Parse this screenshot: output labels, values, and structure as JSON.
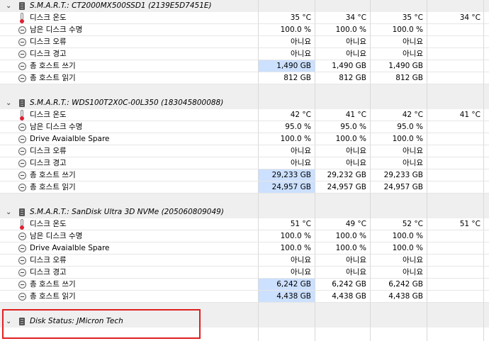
{
  "sections": [
    {
      "title": "S.M.A.R.T.: CT2000MX500SSD1 (2139E5D7451E)",
      "rows": [
        {
          "icon": "thermometer-icon",
          "label": "디스크 온도",
          "values": [
            "35 °C",
            "34 °C",
            "35 °C",
            "34 °C"
          ],
          "highlight": false
        },
        {
          "icon": "gauge-icon",
          "label": "남은 디스크 수명",
          "values": [
            "100.0 %",
            "100.0 %",
            "100.0 %",
            ""
          ],
          "highlight": false
        },
        {
          "icon": "gauge-icon",
          "label": "디스크 오류",
          "values": [
            "아니요",
            "아니요",
            "아니요",
            ""
          ],
          "highlight": false
        },
        {
          "icon": "gauge-icon",
          "label": "디스크 경고",
          "values": [
            "아니요",
            "아니요",
            "아니요",
            ""
          ],
          "highlight": false
        },
        {
          "icon": "gauge-icon",
          "label": "총 호스트 쓰기",
          "values": [
            "1,490 GB",
            "1,490 GB",
            "1,490 GB",
            ""
          ],
          "highlight": true
        },
        {
          "icon": "gauge-icon",
          "label": "총 호스트 읽기",
          "values": [
            "812 GB",
            "812 GB",
            "812 GB",
            ""
          ],
          "highlight": false
        }
      ]
    },
    {
      "title": "S.M.A.R.T.: WDS100T2X0C-00L350 (183045800088)",
      "rows": [
        {
          "icon": "thermometer-icon",
          "label": "디스크 온도",
          "values": [
            "42 °C",
            "41 °C",
            "42 °C",
            "41 °C"
          ],
          "highlight": false
        },
        {
          "icon": "gauge-icon",
          "label": "남은 디스크 수명",
          "values": [
            "95.0 %",
            "95.0 %",
            "95.0 %",
            ""
          ],
          "highlight": false
        },
        {
          "icon": "gauge-icon",
          "label": "Drive Avaialble Spare",
          "values": [
            "100.0 %",
            "100.0 %",
            "100.0 %",
            ""
          ],
          "highlight": false
        },
        {
          "icon": "gauge-icon",
          "label": "디스크 오류",
          "values": [
            "아니요",
            "아니요",
            "아니요",
            ""
          ],
          "highlight": false
        },
        {
          "icon": "gauge-icon",
          "label": "디스크 경고",
          "values": [
            "아니요",
            "아니요",
            "아니요",
            ""
          ],
          "highlight": false
        },
        {
          "icon": "gauge-icon",
          "label": "총 호스트 쓰기",
          "values": [
            "29,233 GB",
            "29,232 GB",
            "29,233 GB",
            ""
          ],
          "highlight": true
        },
        {
          "icon": "gauge-icon",
          "label": "총 호스트 읽기",
          "values": [
            "24,957 GB",
            "24,957 GB",
            "24,957 GB",
            ""
          ],
          "highlight": true
        }
      ]
    },
    {
      "title": "S.M.A.R.T.: SanDisk Ultra 3D NVMe (205060809049)",
      "rows": [
        {
          "icon": "thermometer-icon",
          "label": "디스크 온도",
          "values": [
            "51 °C",
            "49 °C",
            "52 °C",
            "51 °C"
          ],
          "highlight": false
        },
        {
          "icon": "gauge-icon",
          "label": "남은 디스크 수명",
          "values": [
            "100.0 %",
            "100.0 %",
            "100.0 %",
            ""
          ],
          "highlight": false
        },
        {
          "icon": "gauge-icon",
          "label": "Drive Avaialble Spare",
          "values": [
            "100.0 %",
            "100.0 %",
            "100.0 %",
            ""
          ],
          "highlight": false
        },
        {
          "icon": "gauge-icon",
          "label": "디스크 오류",
          "values": [
            "아니요",
            "아니요",
            "아니요",
            ""
          ],
          "highlight": false
        },
        {
          "icon": "gauge-icon",
          "label": "디스크 경고",
          "values": [
            "아니요",
            "아니요",
            "아니요",
            ""
          ],
          "highlight": false
        },
        {
          "icon": "gauge-icon",
          "label": "총 호스트 쓰기",
          "values": [
            "6,242 GB",
            "6,242 GB",
            "6,242 GB",
            ""
          ],
          "highlight": true
        },
        {
          "icon": "gauge-icon",
          "label": "총 호스트 읽기",
          "values": [
            "4,438 GB",
            "4,438 GB",
            "4,438 GB",
            ""
          ],
          "highlight": true
        }
      ]
    },
    {
      "title": "Disk Status: JMicron Tech",
      "rows": []
    }
  ],
  "colors": {
    "highlight": "#cce0ff",
    "header_bg": "#efefef",
    "annotation_box": "#e02020"
  }
}
